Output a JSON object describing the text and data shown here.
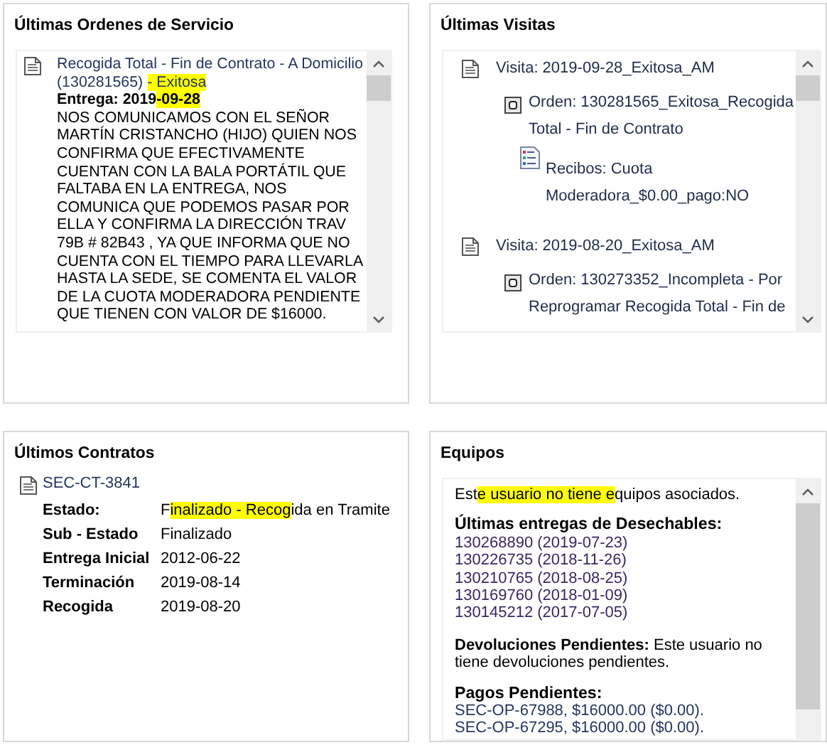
{
  "orders_panel": {
    "title": "Últimas Ordenes de Servicio",
    "orders": [
      {
        "title": [
          {
            "text": "Recogida Total - Fin de Contrato - A Domicilio (130281565) ",
            "highlighted": false
          },
          {
            "text": "- Exitosa",
            "highlighted": true
          }
        ],
        "delivery": [
          {
            "text": "Entrega: 2019",
            "highlighted": false
          },
          {
            "text": "-09-28",
            "highlighted": true
          }
        ],
        "note": "NOS COMUNICAMOS CON EL SEÑOR MARTÍN CRISTANCHO (HIJO) QUIEN NOS CONFIRMA QUE EFECTIVAMENTE CUENTAN CON LA BALA PORTÁTIL QUE FALTABA EN LA ENTREGA, NOS COMUNICA QUE PODEMOS PASAR POR ELLA Y CONFIRMA LA DIRECCIÓN TRAV 79B # 82B43 , YA QUE INFORMA QUE NO CUENTA CON EL TIEMPO PARA LLEVARLA HASTA LA SEDE, SE COMENTA EL VALOR DE LA CUOTA MODERADORA PENDIENTE QUE TIENEN CON VALOR DE $16000."
      }
    ]
  },
  "visits_panel": {
    "title": "Últimas Visitas",
    "visits": [
      {
        "label": "Visita: 2019-09-28_Exitosa_AM",
        "orders": [
          {
            "text": "Orden: 130281565_Exitosa_Recogida Total - Fin de Contrato",
            "receipts": [
              "Recibos: Cuota Moderadora_$0.00_pago:NO"
            ]
          }
        ]
      },
      {
        "label": "Visita: 2019-08-20_Exitosa_AM",
        "orders": [
          {
            "text": "Orden: 130273352_Incompleta - Por Reprogramar  Recogida Total - Fin de"
          }
        ]
      }
    ]
  },
  "contracts_panel": {
    "title": "Últimos Contratos",
    "contracts": [
      {
        "code": "SEC-CT-3841",
        "fields": [
          {
            "label": "Estado:",
            "value": [
              {
                "text": "F",
                "highlighted": false
              },
              {
                "text": "inalizado - Recog",
                "highlighted": true
              },
              {
                "text": "ida en Tramite",
                "highlighted": false
              }
            ]
          },
          {
            "label": "Sub - Estado",
            "value": [
              {
                "text": "Finalizado",
                "highlighted": false
              }
            ]
          },
          {
            "label": "Entrega Inicial",
            "value": [
              {
                "text": "2012-06-22",
                "highlighted": false
              }
            ]
          },
          {
            "label": "Terminación",
            "value": [
              {
                "text": "2019-08-14",
                "highlighted": false
              }
            ]
          },
          {
            "label": "Recogida",
            "value": [
              {
                "text": "2019-08-20",
                "highlighted": false
              }
            ]
          }
        ]
      }
    ]
  },
  "equipment_panel": {
    "title": "Equipos",
    "intro": [
      {
        "text": "Est",
        "highlighted": false
      },
      {
        "text": "e usuario no tiene e",
        "highlighted": true
      },
      {
        "text": "quipos asociados.",
        "highlighted": false
      }
    ],
    "deliveries_heading": "Últimas entregas de Desechables:",
    "deliveries": [
      "130268890 (2019-07-23)",
      "130226735 (2018-11-26)",
      "130210765 (2018-08-25)",
      "130169760 (2018-01-09)",
      "130145212 (2017-07-05)"
    ],
    "returns": "**Devoluciones Pendientes:** Este usuario no tiene devoluciones pendientes.",
    "payments_heading": "Pagos Pendientes:",
    "payments": [
      "SEC-OP-67988, $16000.00 ($0.00).",
      "SEC-OP-67295, $16000.00 ($0.00)."
    ]
  }
}
